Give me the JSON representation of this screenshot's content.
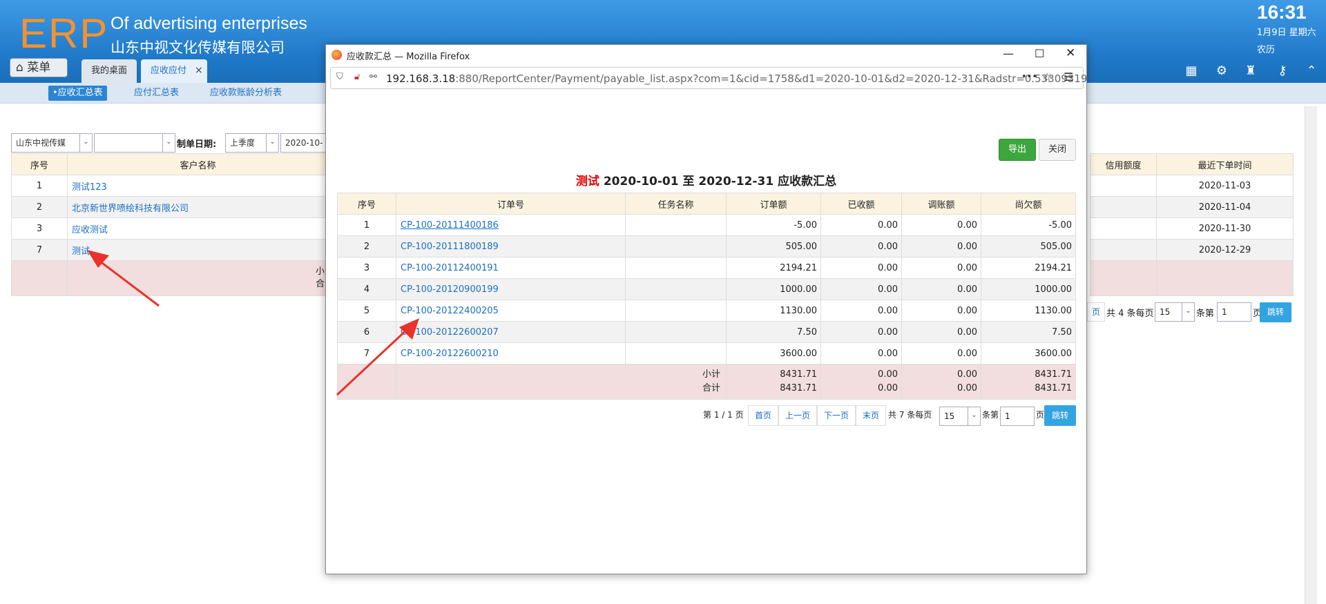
{
  "header": {
    "logo": "ERP",
    "brand_en": "Of advertising enterprises",
    "brand_cn": "山东中视文化传媒有限公司",
    "time": "16:31",
    "date": "1月9日 星期六",
    "lunar": "农历",
    "menu_label": "菜单",
    "tabs": [
      {
        "label": "我的桌面"
      },
      {
        "label": "应收应付"
      }
    ],
    "tab_close": "×"
  },
  "subnav": {
    "items": [
      {
        "label": "•应收汇总表"
      },
      {
        "label": "应付汇总表"
      },
      {
        "label": "应收款账龄分析表"
      }
    ]
  },
  "filter": {
    "company": "山东中视传媒",
    "blank": "",
    "date_label": "制单日期:",
    "period": "上季度",
    "date_from": "2020-10-0"
  },
  "back_table": {
    "headers": {
      "seq": "序号",
      "customer": "客户名称",
      "credit": "信用额度",
      "last_order": "最近下单时间"
    },
    "rows": [
      {
        "seq": "1",
        "customer": "测试123",
        "last_order": "2020-11-03"
      },
      {
        "seq": "2",
        "customer": "北京新世界喷绘科技有限公司",
        "last_order": "2020-11-04"
      },
      {
        "seq": "3",
        "customer": "应收测试",
        "last_order": "2020-11-30"
      },
      {
        "seq": "7",
        "customer": "测试",
        "last_order": "2020-12-29"
      }
    ],
    "subtotal_fragment": "小",
    "total_fragment": "合"
  },
  "back_pager": {
    "last_fragment": "页",
    "total_text": "共 4 条每页",
    "page_size": "15",
    "jump_prefix": "条第",
    "page_no": "1",
    "page_suffix": "页",
    "go": "跳转"
  },
  "modal": {
    "window_title": "应收款汇总 — Mozilla Firefox",
    "url_host": "192.168.3.18",
    "url_rest": ":880/ReportCenter/Payment/payable_list.aspx?com=1&cid=1758&d1=2020-10-01&d2=2020-12-31&Radstr=0.53309319",
    "url_dots": "•••",
    "export_label": "导出",
    "close_label": "关闭",
    "report_customer": "测试",
    "report_title": "2020-10-01 至 2020-12-31 应收款汇总",
    "headers": {
      "seq": "序号",
      "order_no": "订单号",
      "task": "任务名称",
      "amount": "订单额",
      "received": "已收额",
      "adjust": "调账额",
      "owed": "尚欠额"
    },
    "rows": [
      {
        "seq": "1",
        "order_no": "CP-100-20111400186",
        "task": "",
        "amount": "-5.00",
        "received": "0.00",
        "adjust": "0.00",
        "owed": "-5.00"
      },
      {
        "seq": "2",
        "order_no": "CP-100-20111800189",
        "task": "",
        "amount": "505.00",
        "received": "0.00",
        "adjust": "0.00",
        "owed": "505.00"
      },
      {
        "seq": "3",
        "order_no": "CP-100-20112400191",
        "task": "",
        "amount": "2194.21",
        "received": "0.00",
        "adjust": "0.00",
        "owed": "2194.21"
      },
      {
        "seq": "4",
        "order_no": "CP-100-20120900199",
        "task": "",
        "amount": "1000.00",
        "received": "0.00",
        "adjust": "0.00",
        "owed": "1000.00"
      },
      {
        "seq": "5",
        "order_no": "CP-100-20122400205",
        "task": "",
        "amount": "1130.00",
        "received": "0.00",
        "adjust": "0.00",
        "owed": "1130.00"
      },
      {
        "seq": "6",
        "order_no": "CP-100-20122600207",
        "task": "",
        "amount": "7.50",
        "received": "0.00",
        "adjust": "0.00",
        "owed": "7.50"
      },
      {
        "seq": "7",
        "order_no": "CP-100-20122600210",
        "task": "",
        "amount": "3600.00",
        "received": "0.00",
        "adjust": "0.00",
        "owed": "3600.00"
      }
    ],
    "subtotal": {
      "label": "小计",
      "amount": "8431.71",
      "received": "0.00",
      "adjust": "0.00",
      "owed": "8431.71"
    },
    "total": {
      "label": "合计",
      "amount": "8431.71",
      "received": "0.00",
      "adjust": "0.00",
      "owed": "8431.71"
    },
    "pager": {
      "page_info": "第 1 / 1 页",
      "first": "首页",
      "prev": "上一页",
      "next": "下一页",
      "last": "末页",
      "total_text": "共 7 条每页",
      "page_size": "15",
      "jump_prefix": "条第",
      "page_no": "1",
      "page_suffix": "页",
      "go": "跳转"
    }
  },
  "colors": {
    "header_blue": "#2a86d4",
    "logo_orange": "#f5922f",
    "export_green": "#3da73d",
    "red_title": "#e00000",
    "annotation_red": "#e8322b"
  }
}
